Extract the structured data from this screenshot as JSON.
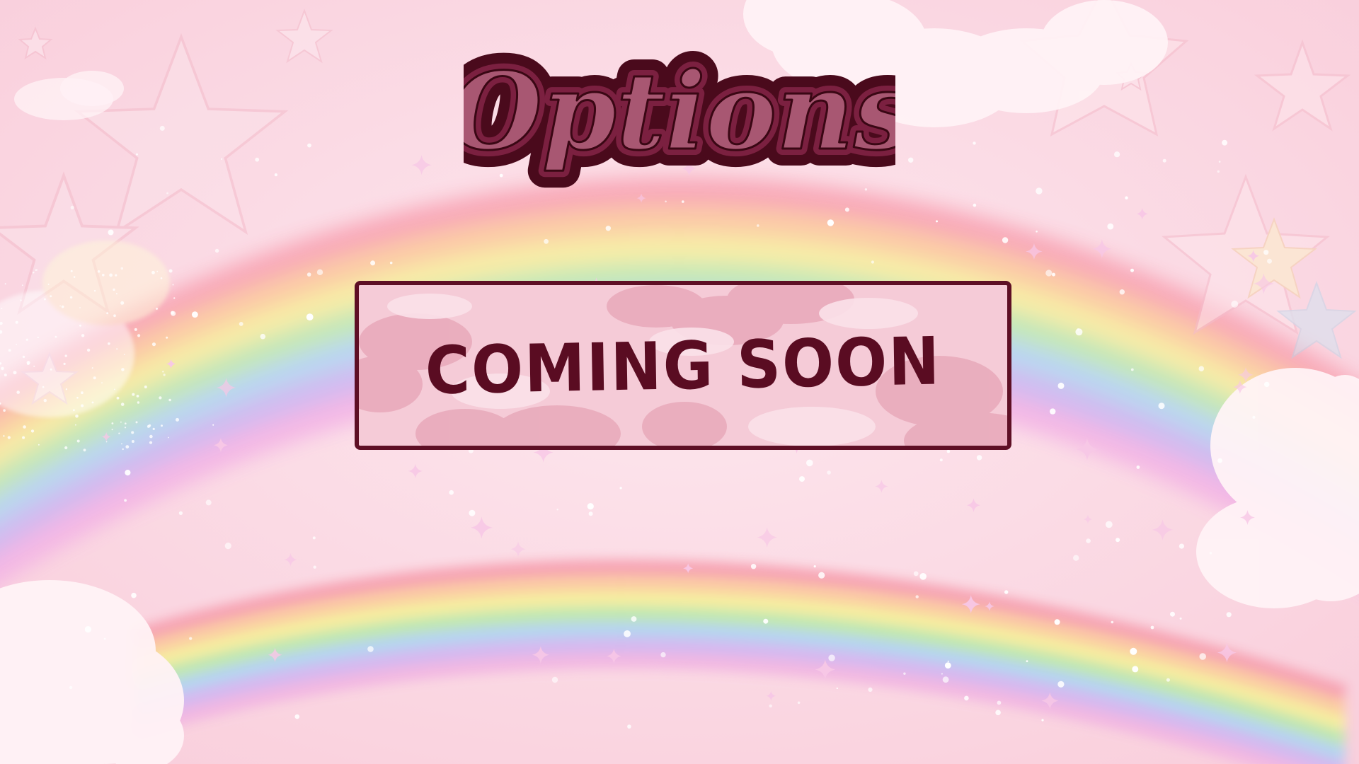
{
  "screen": {
    "title": "Options",
    "panel_message": "COMING SOON"
  },
  "colors": {
    "background": "#fbd7e2",
    "title_outline": "#4a0a1c",
    "title_fill": "#a85772",
    "panel_border": "#5e0f25",
    "panel_text": "#5a0c22"
  },
  "decor": {
    "background_icons": [
      "rainbow-icon",
      "star-icon",
      "cloud-icon",
      "sparkle-icon"
    ]
  }
}
